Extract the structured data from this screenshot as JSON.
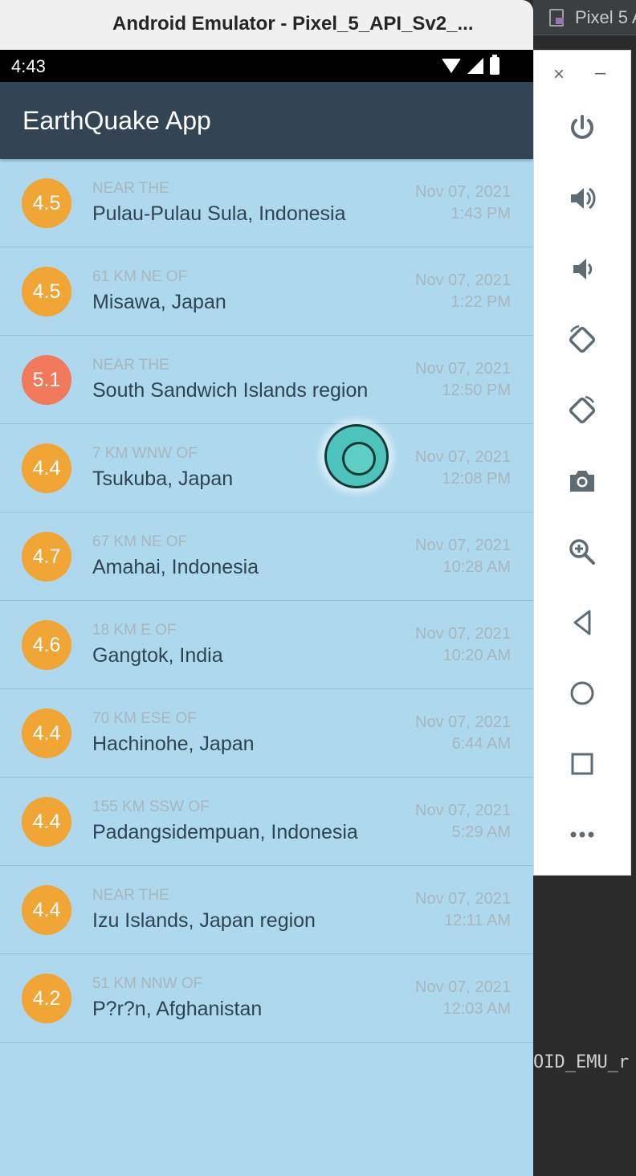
{
  "window": {
    "title": "Android Emulator - Pixel_5_API_Sv2_..."
  },
  "ide": {
    "tab_label": "Pixel 5 A",
    "console_text": "OID_EMU_r"
  },
  "status_bar": {
    "time": "4:43"
  },
  "app": {
    "title": "EarthQuake App"
  },
  "colors": {
    "mag_orange": "#f0a535",
    "mag_red": "#f2795c",
    "list_bg": "#add8ee",
    "appbar": "#334555"
  },
  "quakes": [
    {
      "mag": "4.5",
      "offset": "NEAR THE",
      "place": "Pulau-Pulau Sula, Indonesia",
      "date": "Nov 07, 2021",
      "time": "1:43 PM",
      "color": "#f0a535"
    },
    {
      "mag": "4.5",
      "offset": "61 KM NE OF",
      "place": "Misawa, Japan",
      "date": "Nov 07, 2021",
      "time": "1:22 PM",
      "color": "#f0a535"
    },
    {
      "mag": "5.1",
      "offset": "NEAR THE",
      "place": "South Sandwich Islands region",
      "date": "Nov 07, 2021",
      "time": "12:50 PM",
      "color": "#f2795c"
    },
    {
      "mag": "4.4",
      "offset": "7 KM WNW OF",
      "place": "Tsukuba, Japan",
      "date": "Nov 07, 2021",
      "time": "12:08 PM",
      "color": "#f0a535"
    },
    {
      "mag": "4.7",
      "offset": "67 KM NE OF",
      "place": "Amahai, Indonesia",
      "date": "Nov 07, 2021",
      "time": "10:28 AM",
      "color": "#f0a535"
    },
    {
      "mag": "4.6",
      "offset": "18 KM E OF",
      "place": "Gangtok, India",
      "date": "Nov 07, 2021",
      "time": "10:20 AM",
      "color": "#f0a535"
    },
    {
      "mag": "4.4",
      "offset": "70 KM ESE OF",
      "place": "Hachinohe, Japan",
      "date": "Nov 07, 2021",
      "time": "6:44 AM",
      "color": "#f0a535"
    },
    {
      "mag": "4.4",
      "offset": "155 KM SSW OF",
      "place": "Padangsidempuan, Indonesia",
      "date": "Nov 07, 2021",
      "time": "5:29 AM",
      "color": "#f0a535"
    },
    {
      "mag": "4.4",
      "offset": "NEAR THE",
      "place": "Izu Islands, Japan region",
      "date": "Nov 07, 2021",
      "time": "12:11 AM",
      "color": "#f0a535"
    },
    {
      "mag": "4.2",
      "offset": "51 KM NNW OF",
      "place": "P?r?n, Afghanistan",
      "date": "Nov 07, 2021",
      "time": "12:03 AM",
      "color": "#f0a535"
    }
  ],
  "toolbar": {
    "close_glyph": "×",
    "minimize_glyph": "–",
    "buttons": [
      "power-icon",
      "volume-up-icon",
      "volume-down-icon",
      "rotate-left-icon",
      "rotate-right-icon",
      "camera-icon",
      "zoom-icon",
      "back-icon",
      "home-icon",
      "overview-icon",
      "more-icon"
    ]
  }
}
